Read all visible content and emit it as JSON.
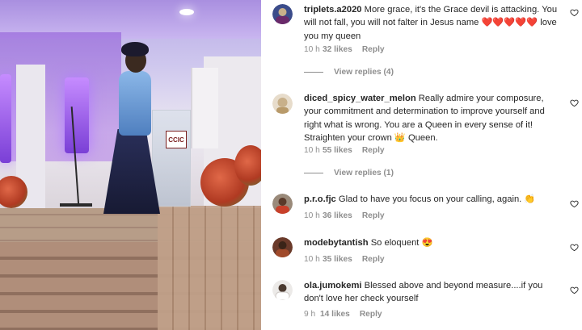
{
  "photo": {
    "podium_text": "CCIC"
  },
  "comments": [
    {
      "username": "triplets.a2020",
      "text": "More grace, it's the Grace devil is attacking. You will not fall, you will not falter in Jesus name ❤️❤️❤️❤️❤️ love you my queen",
      "time": "10 h",
      "likes": "32 likes",
      "reply": "Reply",
      "view_replies": "View replies (4)",
      "avatar_color": "#3b4c8a"
    },
    {
      "username": "diced_spicy_water_melon",
      "text": "Really admire your composure, your commitment and determination to improve yourself and right what is wrong. You are a Queen in every sense of it! Straighten your crown 👑 Queen.",
      "time": "10 h",
      "likes": "55 likes",
      "reply": "Reply",
      "view_replies": "View replies (1)",
      "avatar_color": "#d9c7a8"
    },
    {
      "username": "p.r.o.fjc",
      "text": "Glad to have you focus on your calling, again. 👏",
      "time": "10 h",
      "likes": "36 likes",
      "reply": "Reply",
      "avatar_color": "#7a5a4a"
    },
    {
      "username": "modebytantish",
      "text": "So eloquent 😍",
      "time": "10 h",
      "likes": "35 likes",
      "reply": "Reply",
      "avatar_color": "#8a3b2a"
    },
    {
      "username": "ola.jumokemi",
      "text": "Blessed above and beyond measure....if you don't love her check yourself",
      "time": "9 h",
      "likes": "14 likes",
      "reply": "Reply",
      "avatar_color": "#e8e6e4"
    }
  ]
}
